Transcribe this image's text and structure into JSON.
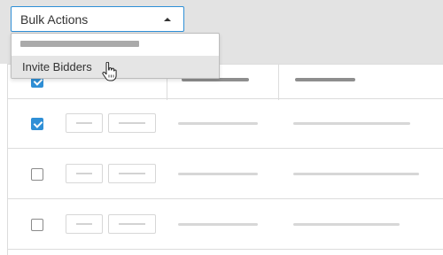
{
  "bulk_actions": {
    "label": "Bulk Actions",
    "options": [
      "Invite Bidders"
    ]
  },
  "rows": [
    {
      "checked": true
    },
    {
      "checked": false
    },
    {
      "checked": false
    }
  ],
  "header": {
    "select_all_checked": true
  }
}
